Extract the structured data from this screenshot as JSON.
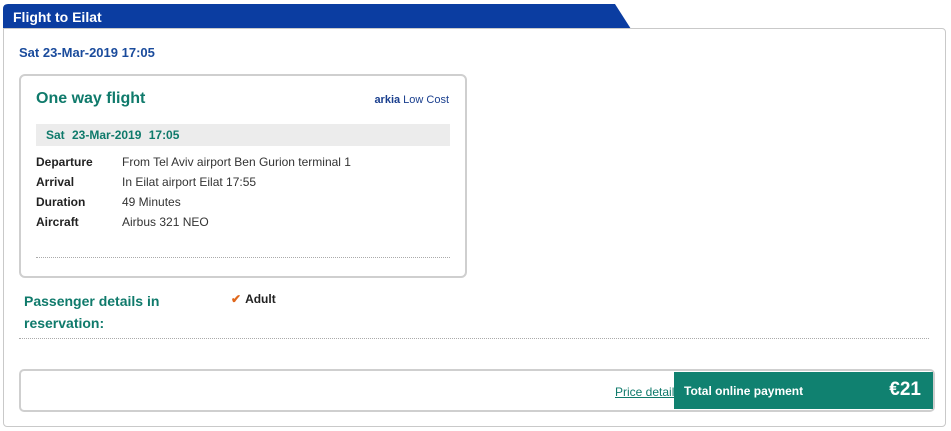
{
  "tab": {
    "title": "Flight to Eilat",
    "color": "#0b3da1"
  },
  "date_header": "Sat 23-Mar-2019 17:05",
  "flight_card": {
    "title": "One way flight",
    "airline_logo": {
      "brand": "arkia",
      "suffix": "Low Cost"
    },
    "date": "Sat  23-Mar-2019  17:05",
    "rows": [
      {
        "label": "Departure",
        "value": "From Tel Aviv airport Ben Gurion terminal 1"
      },
      {
        "label": "Arrival",
        "value": "In Eilat airport Eilat 17:55"
      },
      {
        "label": "Duration",
        "value": "49 Minutes"
      },
      {
        "label": "Aircraft",
        "value": "Airbus 321 NEO"
      }
    ]
  },
  "passenger": {
    "label": "Passenger details in reservation:",
    "value": "Adult",
    "check_icon": "check-icon"
  },
  "payment": {
    "price_details_link": "Price details",
    "total_label": "Total online payment",
    "total_amount": "€21",
    "accent_color": "#108170"
  }
}
